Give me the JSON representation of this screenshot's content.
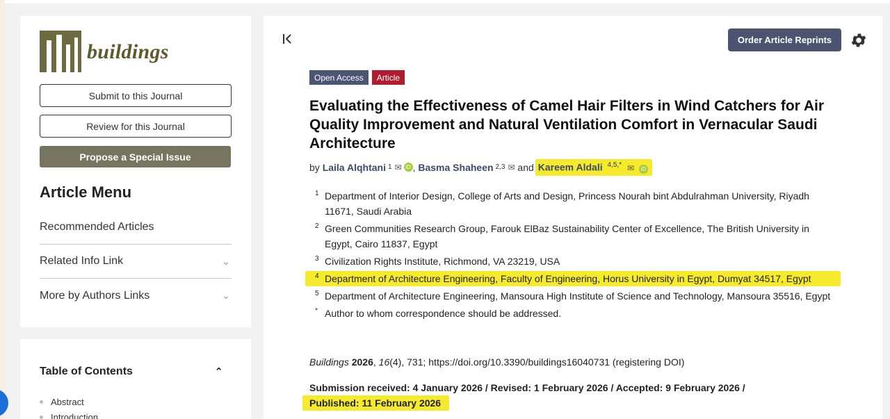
{
  "journal": {
    "name": "buildings"
  },
  "sidebar": {
    "submit_label": "Submit to this Journal",
    "review_label": "Review for this Journal",
    "propose_label": "Propose a Special Issue",
    "menu_title": "Article Menu",
    "menu_items": [
      {
        "label": "Recommended Articles",
        "has_chevron": false
      },
      {
        "label": "Related Info Link",
        "has_chevron": true
      },
      {
        "label": "More by Authors Links",
        "has_chevron": true
      }
    ]
  },
  "toc": {
    "title": "Table of Contents",
    "items": [
      "Abstract",
      "Introduction"
    ]
  },
  "toolbar": {
    "order_label": "Order Article Reprints"
  },
  "article": {
    "badges": [
      "Open Access",
      "Article"
    ],
    "title": "Evaluating the Effectiveness of Camel Hair Filters in Wind Catchers for Air Quality Improvement and Natural Ventilation Comfort in Vernacular Saudi Architecture",
    "by": "by",
    "and": "and",
    "authors": [
      {
        "name": "Laila Alqhtani",
        "sup": "1"
      },
      {
        "name": "Basma Shaheen",
        "sup": "2,3"
      },
      {
        "name": "Kareem Aldali",
        "sup": "4,5,*"
      }
    ],
    "affiliations": [
      {
        "n": "1",
        "text": "Department of Interior Design, College of Arts and Design, Princess Nourah bint Abdulrahman University, Riyadh 11671, Saudi Arabia"
      },
      {
        "n": "2",
        "text": "Green Communities Research Group, Farouk ElBaz Sustainability Center of Excellence, The British University in Egypt, Cairo 11837, Egypt"
      },
      {
        "n": "3",
        "text": "Civilization Rights Institute, Richmond, VA 23219, USA"
      },
      {
        "n": "4",
        "text": "Department of Architecture Engineering, Faculty of Engineering, Horus University in Egypt, Dumyat 34517, Egypt"
      },
      {
        "n": "5",
        "text": "Department of Architecture Engineering, Mansoura High Institute of Science and Technology, Mansoura 35516, Egypt"
      },
      {
        "n": "*",
        "text": "Author to whom correspondence should be addressed."
      }
    ],
    "citation": {
      "journal": "Buildings",
      "year": "2026",
      "volume": "16",
      "issue_pages": "(4), 731; https://doi.org/10.3390/buildings16040731 (registering DOI)"
    },
    "dates": {
      "line1": "Submission received: 4 January 2026 / Revised: 1 February 2026 / Accepted: 9 February 2026 /",
      "line2": "Published: 11 February 2026"
    }
  },
  "colors": {
    "accent": "#4b5470",
    "article_badge": "#b01c2e",
    "highlight": "#f5ea2c",
    "journal": "#6c6a3e"
  }
}
